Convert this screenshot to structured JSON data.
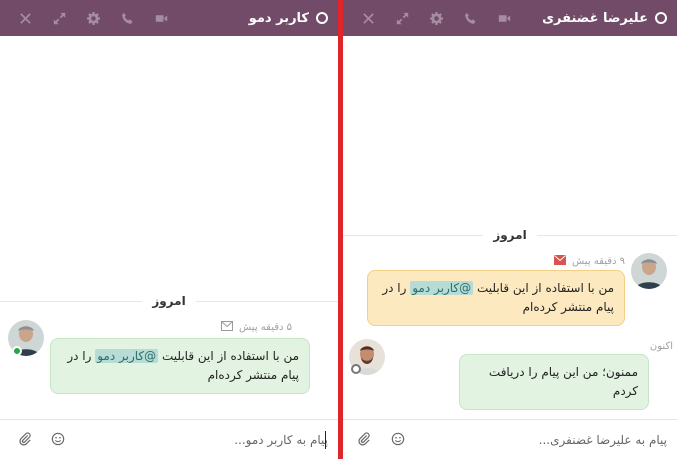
{
  "left_chat": {
    "title": "کاربر دمو",
    "day_label": "امروز",
    "message": {
      "time": "۵ دقیقه پیش",
      "text_before": "من با استفاده از این قابلیت ",
      "mention": "@کاربر دمو",
      "text_after": " را در پیام منتشر کرده‌ام"
    },
    "composer_placeholder": "پیام به کاربر دمو..."
  },
  "right_chat": {
    "title": "علیرضا غضنفری",
    "day_label": "امروز",
    "message": {
      "time": "۹ دقیقه پیش",
      "text_before": "من با استفاده از این قابلیت ",
      "mention": "@کاربر دمو",
      "text_after": " را در پیام منتشر کرده‌ام"
    },
    "reply": {
      "time": "اکنون",
      "text": "ممنون؛ من این پیام را دریافت کردم"
    },
    "composer_placeholder": "پیام به علیرضا غضنفری..."
  },
  "header_icons": [
    "close-icon",
    "expand-icon",
    "gear-icon",
    "phone-icon",
    "video-camera-icon"
  ],
  "colors": {
    "header": "#714b67",
    "header_icon": "#a58ca0",
    "divider": "#e0262a",
    "bubble_green": "#e2f3e2",
    "bubble_yellow": "#fde9c0",
    "mention": "#b7dbd5",
    "envelope_unread": "#d9534f"
  }
}
